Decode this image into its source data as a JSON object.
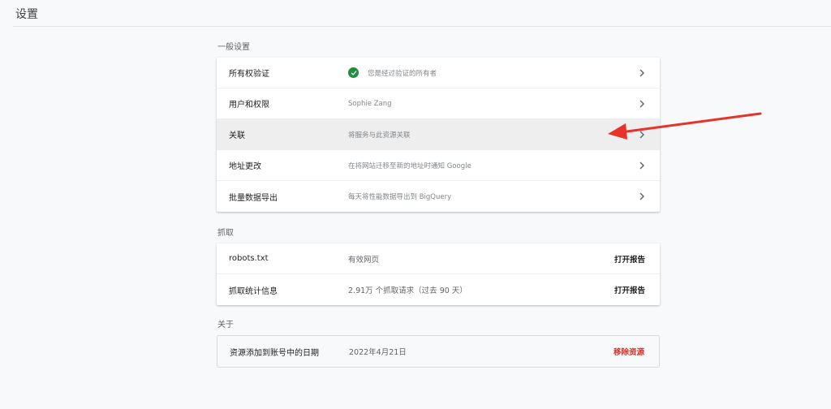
{
  "header": {
    "title": "设置"
  },
  "sections": {
    "general": {
      "label": "一般设置",
      "rows": [
        {
          "label": "所有权验证",
          "value": "您是经过验证的所有者",
          "icon": "check-circle-icon"
        },
        {
          "label": "用户和权限",
          "value": "Sophie Zang"
        },
        {
          "label": "关联",
          "value": "将服务与此资源关联"
        },
        {
          "label": "地址更改",
          "value": "在将网站迁移至新的地址时通知 Google"
        },
        {
          "label": "批量数据导出",
          "value": "每天将性能数据导出到 BigQuery"
        }
      ]
    },
    "crawl": {
      "label": "抓取",
      "rows": [
        {
          "label": "robots.txt",
          "value": "有效网页",
          "action": "打开报告"
        },
        {
          "label": "抓取统计信息",
          "value": "2.91万 个抓取请求（过去 90 天）",
          "action": "打开报告"
        }
      ]
    },
    "about": {
      "label": "关于",
      "rows": [
        {
          "label": "资源添加到账号中的日期",
          "value": "2022年4月21日",
          "action": "移除资源"
        }
      ]
    }
  },
  "colors": {
    "verified": "#1e8e3e",
    "danger": "#d93025",
    "annotation_arrow": "#e8332a"
  }
}
